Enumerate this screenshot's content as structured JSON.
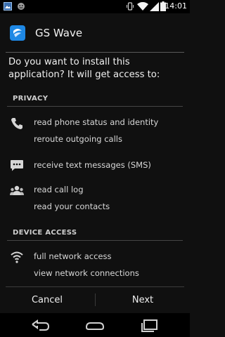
{
  "status_bar": {
    "time": "14:01",
    "left_icons": [
      "gallery-icon",
      "robot-icon"
    ],
    "right_icons": [
      "vibrate-icon",
      "wifi-icon",
      "cell-signal-icon",
      "battery-icon"
    ]
  },
  "app": {
    "name": "GS Wave",
    "icon": "gs-wave-app-icon",
    "accent": "#1e88e5"
  },
  "install_prompt": {
    "question": "Do you want to install this application? It will get access to:"
  },
  "sections": {
    "privacy": {
      "label": "PRIVACY",
      "groups": {
        "phone": {
          "icon": "phone-icon",
          "items": [
            "read phone status and identity",
            "reroute outgoing calls"
          ]
        },
        "sms": {
          "icon": "sms-icon",
          "items": [
            "receive text messages (SMS)"
          ]
        },
        "contacts": {
          "icon": "contacts-icon",
          "items": [
            "read call log",
            "read your contacts"
          ]
        }
      }
    },
    "device_access": {
      "label": "DEVICE ACCESS",
      "groups": {
        "network": {
          "icon": "wifi-icon",
          "items": [
            "full network access",
            "view network connections"
          ]
        }
      }
    }
  },
  "buttons": {
    "cancel": "Cancel",
    "next": "Next"
  },
  "nav_bar": {
    "icons": [
      "back-icon",
      "home-icon",
      "recent-apps-icon"
    ]
  }
}
